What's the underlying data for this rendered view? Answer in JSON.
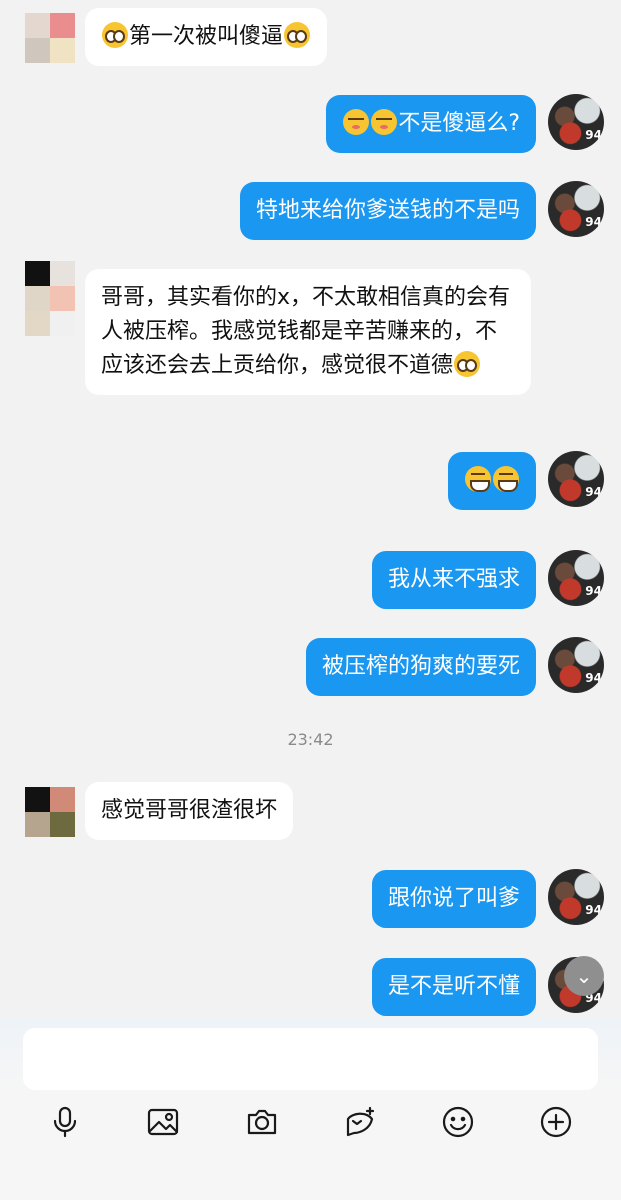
{
  "messages": [
    {
      "dir": "in",
      "parts": [
        {
          "e": "plead"
        },
        {
          "t": "第一次被叫傻逼"
        },
        {
          "e": "plead"
        }
      ]
    },
    {
      "dir": "out",
      "parts": [
        {
          "e": "poke"
        },
        {
          "e": "poke"
        },
        {
          "t": "不是傻逼么?"
        }
      ]
    },
    {
      "dir": "out",
      "parts": [
        {
          "t": "特地来给你爹送钱的不是吗"
        }
      ]
    },
    {
      "dir": "in",
      "parts": [
        {
          "t": "哥哥，其实看你的x，不太敢相信真的会有人被压榨。我感觉钱都是辛苦赚来的，不应该还会去上贡给你，感觉很不道德"
        },
        {
          "e": "plead"
        }
      ]
    },
    {
      "dir": "out",
      "parts": [
        {
          "e": "grin"
        },
        {
          "e": "grin"
        }
      ]
    },
    {
      "dir": "out",
      "parts": [
        {
          "t": "我从来不强求"
        }
      ]
    },
    {
      "dir": "out",
      "parts": [
        {
          "t": "被压榨的狗爽的要死"
        }
      ]
    },
    {
      "dir": "in",
      "parts": [
        {
          "t": "感觉哥哥很渣很坏"
        }
      ]
    },
    {
      "dir": "out",
      "parts": [
        {
          "t": "跟你说了叫爹"
        }
      ]
    },
    {
      "dir": "out",
      "parts": [
        {
          "t": "是不是听不懂"
        }
      ]
    }
  ],
  "timestamp": "23:42",
  "composer": {
    "placeholder": ""
  },
  "toolbar": [
    "microphone-icon",
    "image-icon",
    "camera-icon",
    "sticker-icon",
    "emoji-icon",
    "plus-icon"
  ],
  "colors": {
    "outgoing": "#1a97f0",
    "incoming": "#ffffff",
    "background": "#f2f2f2"
  }
}
